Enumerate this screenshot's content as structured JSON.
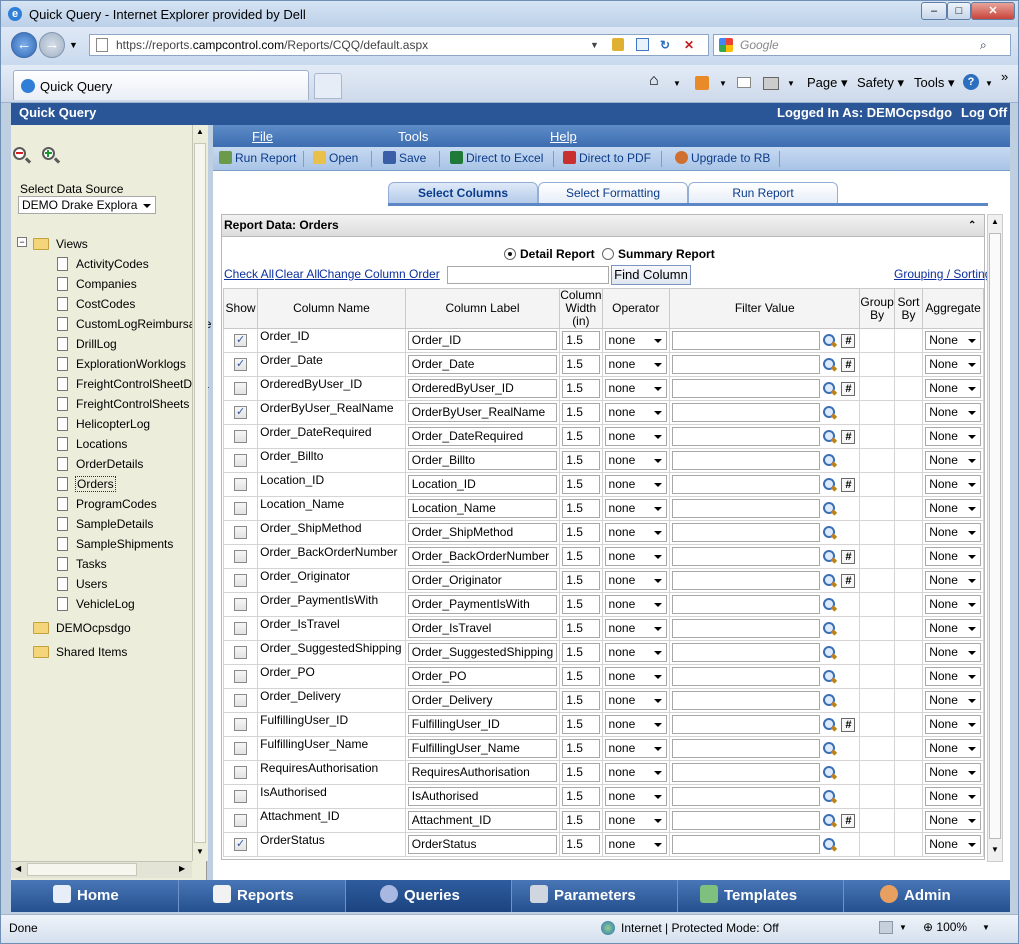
{
  "browser": {
    "window_title": "Quick Query - Internet Explorer provided by Dell",
    "url_prefix": "https://reports.",
    "url_domain": "campcontrol.com",
    "url_path": "/Reports/CQQ/default.aspx",
    "search_placeholder": "Google",
    "tab_title": "Quick Query",
    "toolbar": {
      "page": "Page",
      "safety": "Safety",
      "tools": "Tools"
    },
    "status_left": "Done",
    "status_zone": "Internet | Protected Mode: Off",
    "zoom": "100%"
  },
  "app": {
    "title": "Quick Query",
    "logged_in": "Logged In As: DEMOcpsdgo",
    "logoff": "Log Off"
  },
  "sidebar": {
    "data_source_label": "Select Data Source",
    "data_source_value": "DEMO Drake Explora",
    "root": "Views",
    "views": [
      "ActivityCodes",
      "Companies",
      "CostCodes",
      "CustomLogReimbursable",
      "DrillLog",
      "ExplorationWorklogs",
      "FreightControlSheetDeta",
      "FreightControlSheets",
      "HelicopterLog",
      "Locations",
      "OrderDetails",
      "Orders",
      "ProgramCodes",
      "SampleDetails",
      "SampleShipments",
      "Tasks",
      "Users",
      "VehicleLog"
    ],
    "folders": [
      "DEMOcpsdgo",
      "Shared Items"
    ]
  },
  "menu": {
    "file": "File",
    "tools": "Tools",
    "help": "Help"
  },
  "toolbar": {
    "run_report": "Run Report",
    "open": "Open",
    "save": "Save",
    "excel": "Direct to Excel",
    "pdf": "Direct to PDF",
    "upgrade": "Upgrade to RB"
  },
  "tabs": [
    "Select Columns",
    "Select Formatting",
    "Run Report"
  ],
  "panel": {
    "header": "Report Data: Orders",
    "detail_report": "Detail Report",
    "summary_report": "Summary Report",
    "check_all": "Check All",
    "clear_all": "Clear All",
    "change_order": "Change Column Order",
    "find_column": "Find Column",
    "grouping": "Grouping / Sorting"
  },
  "table": {
    "headers": {
      "show": "Show",
      "name": "Column Name",
      "label": "Column Label",
      "width": "Column Width (in)",
      "operator": "Operator",
      "filter": "Filter Value",
      "group": "Group By",
      "sort": "Sort By",
      "aggregate": "Aggregate"
    },
    "rows": [
      {
        "name": "Order_ID",
        "label": "Order_ID",
        "width": "1.5",
        "op": "none",
        "agg": "None",
        "checked": true,
        "hash": true
      },
      {
        "name": "Order_Date",
        "label": "Order_Date",
        "width": "1.5",
        "op": "none",
        "agg": "None",
        "checked": true,
        "hash": true
      },
      {
        "name": "OrderedByUser_ID",
        "label": "OrderedByUser_ID",
        "width": "1.5",
        "op": "none",
        "agg": "None",
        "checked": false,
        "hash": true
      },
      {
        "name": "OrderByUser_RealName",
        "label": "OrderByUser_RealName",
        "width": "1.5",
        "op": "none",
        "agg": "None",
        "checked": true,
        "hash": false
      },
      {
        "name": "Order_DateRequired",
        "label": "Order_DateRequired",
        "width": "1.5",
        "op": "none",
        "agg": "None",
        "checked": false,
        "hash": true
      },
      {
        "name": "Order_Billto",
        "label": "Order_Billto",
        "width": "1.5",
        "op": "none",
        "agg": "None",
        "checked": false,
        "hash": false
      },
      {
        "name": "Location_ID",
        "label": "Location_ID",
        "width": "1.5",
        "op": "none",
        "agg": "None",
        "checked": false,
        "hash": true
      },
      {
        "name": "Location_Name",
        "label": "Location_Name",
        "width": "1.5",
        "op": "none",
        "agg": "None",
        "checked": false,
        "hash": false
      },
      {
        "name": "Order_ShipMethod",
        "label": "Order_ShipMethod",
        "width": "1.5",
        "op": "none",
        "agg": "None",
        "checked": false,
        "hash": false
      },
      {
        "name": "Order_BackOrderNumber",
        "label": "Order_BackOrderNumber",
        "width": "1.5",
        "op": "none",
        "agg": "None",
        "checked": false,
        "hash": true
      },
      {
        "name": "Order_Originator",
        "label": "Order_Originator",
        "width": "1.5",
        "op": "none",
        "agg": "None",
        "checked": false,
        "hash": true
      },
      {
        "name": "Order_PaymentIsWith",
        "label": "Order_PaymentIsWith",
        "width": "1.5",
        "op": "none",
        "agg": "None",
        "checked": false,
        "hash": false
      },
      {
        "name": "Order_IsTravel",
        "label": "Order_IsTravel",
        "width": "1.5",
        "op": "none",
        "agg": "None",
        "checked": false,
        "hash": false
      },
      {
        "name": "Order_SuggestedShipping",
        "label": "Order_SuggestedShipping",
        "width": "1.5",
        "op": "none",
        "agg": "None",
        "checked": false,
        "hash": false
      },
      {
        "name": "Order_PO",
        "label": "Order_PO",
        "width": "1.5",
        "op": "none",
        "agg": "None",
        "checked": false,
        "hash": false
      },
      {
        "name": "Order_Delivery",
        "label": "Order_Delivery",
        "width": "1.5",
        "op": "none",
        "agg": "None",
        "checked": false,
        "hash": false
      },
      {
        "name": "FulfillingUser_ID",
        "label": "FulfillingUser_ID",
        "width": "1.5",
        "op": "none",
        "agg": "None",
        "checked": false,
        "hash": true
      },
      {
        "name": "FulfillingUser_Name",
        "label": "FulfillingUser_Name",
        "width": "1.5",
        "op": "none",
        "agg": "None",
        "checked": false,
        "hash": false
      },
      {
        "name": "RequiresAuthorisation",
        "label": "RequiresAuthorisation",
        "width": "1.5",
        "op": "none",
        "agg": "None",
        "checked": false,
        "hash": false
      },
      {
        "name": "IsAuthorised",
        "label": "IsAuthorised",
        "width": "1.5",
        "op": "none",
        "agg": "None",
        "checked": false,
        "hash": false
      },
      {
        "name": "Attachment_ID",
        "label": "Attachment_ID",
        "width": "1.5",
        "op": "none",
        "agg": "None",
        "checked": false,
        "hash": true
      },
      {
        "name": "OrderStatus",
        "label": "OrderStatus",
        "width": "1.5",
        "op": "none",
        "agg": "None",
        "checked": true,
        "hash": false
      }
    ]
  },
  "bottom_nav": [
    "Home",
    "Reports",
    "Queries",
    "Parameters",
    "Templates",
    "Admin"
  ]
}
